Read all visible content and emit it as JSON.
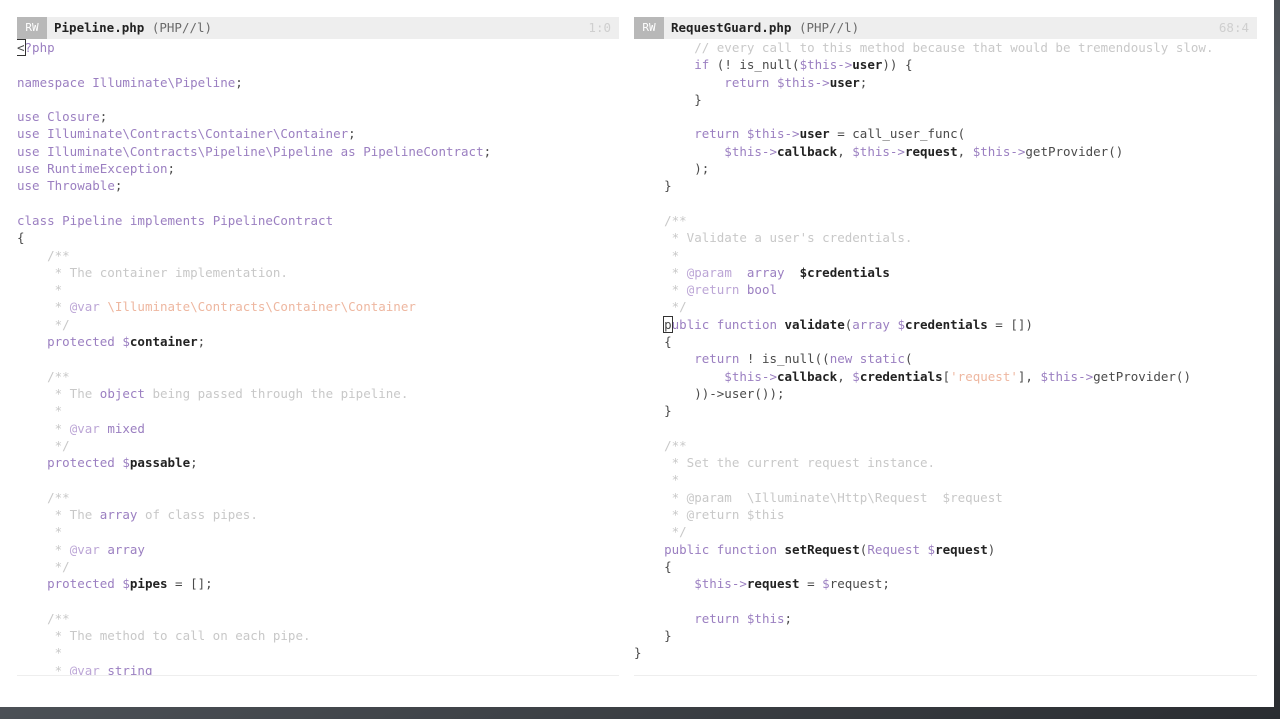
{
  "left_pane": {
    "mode": "RW",
    "filename": "Pipeline.php",
    "filetype": "(PHP//l)",
    "position": "1:0",
    "lines": [
      [
        [
          "<",
          "cursor"
        ],
        [
          "?php",
          "key"
        ]
      ],
      [],
      [
        [
          "namespace ",
          "key"
        ],
        [
          "Illuminate\\Pipeline",
          "cls"
        ],
        [
          ";",
          "plain"
        ]
      ],
      [],
      [
        [
          "use ",
          "key"
        ],
        [
          "Closure",
          "cls"
        ],
        [
          ";",
          "plain"
        ]
      ],
      [
        [
          "use ",
          "key"
        ],
        [
          "Illuminate\\Contracts\\Container\\Container",
          "cls"
        ],
        [
          ";",
          "plain"
        ]
      ],
      [
        [
          "use ",
          "key"
        ],
        [
          "Illuminate\\Contracts\\Pipeline\\Pipeline ",
          "cls"
        ],
        [
          "as ",
          "key"
        ],
        [
          "PipelineContract",
          "cls"
        ],
        [
          ";",
          "plain"
        ]
      ],
      [
        [
          "use ",
          "key"
        ],
        [
          "RuntimeException",
          "cls"
        ],
        [
          ";",
          "plain"
        ]
      ],
      [
        [
          "use ",
          "key"
        ],
        [
          "Throwable",
          "cls"
        ],
        [
          ";",
          "plain"
        ]
      ],
      [],
      [
        [
          "class ",
          "key"
        ],
        [
          "Pipeline ",
          "cls"
        ],
        [
          "implements ",
          "key"
        ],
        [
          "PipelineContract",
          "cls"
        ]
      ],
      [
        [
          "{",
          "plain"
        ]
      ],
      [
        [
          "    /**",
          "cmt"
        ]
      ],
      [
        [
          "     * The container implementation.",
          "cmt"
        ]
      ],
      [
        [
          "     *",
          "cmt"
        ]
      ],
      [
        [
          "     * ",
          "cmt"
        ],
        [
          "@var ",
          "doc"
        ],
        [
          "\\Illuminate\\Contracts\\Container\\Container",
          "str"
        ]
      ],
      [
        [
          "     */",
          "cmt"
        ]
      ],
      [
        [
          "    protected ",
          "key"
        ],
        [
          "$",
          "var"
        ],
        [
          "container",
          "bold"
        ],
        [
          ";",
          "plain"
        ]
      ],
      [],
      [
        [
          "    /**",
          "cmt"
        ]
      ],
      [
        [
          "     * The ",
          "cmt"
        ],
        [
          "object",
          "key"
        ],
        [
          " being passed through the pipeline.",
          "cmt"
        ]
      ],
      [
        [
          "     *",
          "cmt"
        ]
      ],
      [
        [
          "     * ",
          "cmt"
        ],
        [
          "@var ",
          "doc"
        ],
        [
          "mixed",
          "key"
        ]
      ],
      [
        [
          "     */",
          "cmt"
        ]
      ],
      [
        [
          "    protected ",
          "key"
        ],
        [
          "$",
          "var"
        ],
        [
          "passable",
          "bold"
        ],
        [
          ";",
          "plain"
        ]
      ],
      [],
      [
        [
          "    /**",
          "cmt"
        ]
      ],
      [
        [
          "     * The ",
          "cmt"
        ],
        [
          "array",
          "key"
        ],
        [
          " of class pipes.",
          "cmt"
        ]
      ],
      [
        [
          "     *",
          "cmt"
        ]
      ],
      [
        [
          "     * ",
          "cmt"
        ],
        [
          "@var ",
          "doc"
        ],
        [
          "array",
          "key"
        ]
      ],
      [
        [
          "     */",
          "cmt"
        ]
      ],
      [
        [
          "    protected ",
          "key"
        ],
        [
          "$",
          "var"
        ],
        [
          "pipes",
          "bold"
        ],
        [
          " = [];",
          "plain"
        ]
      ],
      [],
      [
        [
          "    /**",
          "cmt"
        ]
      ],
      [
        [
          "     * The method to call on each pipe.",
          "cmt"
        ]
      ],
      [
        [
          "     *",
          "cmt"
        ]
      ],
      [
        [
          "     * ",
          "cmt"
        ],
        [
          "@var ",
          "doc"
        ],
        [
          "string",
          "key"
        ]
      ]
    ]
  },
  "right_pane": {
    "mode": "RW",
    "filename": "RequestGuard.php",
    "filetype": "(PHP//l)",
    "position": "68:4",
    "lines": [
      [
        [
          "        // every call to this method because that would be tremendously slow.",
          "cmt"
        ]
      ],
      [
        [
          "        if ",
          "key"
        ],
        [
          "(! is_null(",
          "plain"
        ],
        [
          "$this->",
          "var"
        ],
        [
          "user",
          "bold"
        ],
        [
          ")) {",
          "plain"
        ]
      ],
      [
        [
          "            return ",
          "key"
        ],
        [
          "$this->",
          "var"
        ],
        [
          "user",
          "bold"
        ],
        [
          ";",
          "plain"
        ]
      ],
      [
        [
          "        }",
          "plain"
        ]
      ],
      [],
      [
        [
          "        return ",
          "key"
        ],
        [
          "$this->",
          "var"
        ],
        [
          "user",
          "bold"
        ],
        [
          " = call_user_func(",
          "plain"
        ]
      ],
      [
        [
          "            $this->",
          "var"
        ],
        [
          "callback",
          "bold"
        ],
        [
          ", ",
          "plain"
        ],
        [
          "$this->",
          "var"
        ],
        [
          "request",
          "bold"
        ],
        [
          ", ",
          "plain"
        ],
        [
          "$this->",
          "var"
        ],
        [
          "getProvider()",
          "plain"
        ]
      ],
      [
        [
          "        );",
          "plain"
        ]
      ],
      [
        [
          "    }",
          "plain"
        ]
      ],
      [],
      [
        [
          "    /**",
          "cmt"
        ]
      ],
      [
        [
          "     * Validate a user's credentials.",
          "cmt"
        ]
      ],
      [
        [
          "     *",
          "cmt"
        ]
      ],
      [
        [
          "     * ",
          "cmt"
        ],
        [
          "@param  ",
          "doc"
        ],
        [
          "array  ",
          "key"
        ],
        [
          "$credentials",
          "bold"
        ]
      ],
      [
        [
          "     * ",
          "cmt"
        ],
        [
          "@return ",
          "doc"
        ],
        [
          "bool",
          "key"
        ]
      ],
      [
        [
          "     */",
          "cmt"
        ]
      ],
      [
        [
          "    ",
          "plain"
        ],
        [
          "p",
          "cursor"
        ],
        [
          "ublic function ",
          "key"
        ],
        [
          "validate",
          "bold"
        ],
        [
          "(",
          "plain"
        ],
        [
          "array ",
          "key"
        ],
        [
          "$",
          "var"
        ],
        [
          "credentials",
          "bold"
        ],
        [
          " = [])",
          "plain"
        ]
      ],
      [
        [
          "    {",
          "plain"
        ]
      ],
      [
        [
          "        return ",
          "key"
        ],
        [
          "! is_null((",
          "plain"
        ],
        [
          "new static",
          "key"
        ],
        [
          "(",
          "plain"
        ]
      ],
      [
        [
          "            $this->",
          "var"
        ],
        [
          "callback",
          "bold"
        ],
        [
          ", ",
          "plain"
        ],
        [
          "$",
          "var"
        ],
        [
          "credentials",
          "bold"
        ],
        [
          "[",
          "plain"
        ],
        [
          "'request'",
          "str"
        ],
        [
          "], ",
          "plain"
        ],
        [
          "$this->",
          "var"
        ],
        [
          "getProvider()",
          "plain"
        ]
      ],
      [
        [
          "        ))->user());",
          "plain"
        ]
      ],
      [
        [
          "    }",
          "plain"
        ]
      ],
      [],
      [
        [
          "    /**",
          "cmt"
        ]
      ],
      [
        [
          "     * Set the current request instance.",
          "cmt"
        ]
      ],
      [
        [
          "     *",
          "cmt"
        ]
      ],
      [
        [
          "     * @param  \\Illuminate\\Http\\Request  $request",
          "cmt"
        ]
      ],
      [
        [
          "     * @return $this",
          "cmt"
        ]
      ],
      [
        [
          "     */",
          "cmt"
        ]
      ],
      [
        [
          "    public function ",
          "key"
        ],
        [
          "setRequest",
          "bold"
        ],
        [
          "(",
          "plain"
        ],
        [
          "Request ",
          "cls"
        ],
        [
          "$",
          "var"
        ],
        [
          "request",
          "bold"
        ],
        [
          ")",
          "plain"
        ]
      ],
      [
        [
          "    {",
          "plain"
        ]
      ],
      [
        [
          "        $this->",
          "var"
        ],
        [
          "request",
          "bold"
        ],
        [
          " = ",
          "plain"
        ],
        [
          "$",
          "var"
        ],
        [
          "request",
          "plain"
        ],
        [
          ";",
          "plain"
        ]
      ],
      [],
      [
        [
          "        return ",
          "key"
        ],
        [
          "$this",
          "var"
        ],
        [
          ";",
          "plain"
        ]
      ],
      [
        [
          "    }",
          "plain"
        ]
      ],
      [
        [
          "}",
          "plain"
        ]
      ]
    ]
  }
}
